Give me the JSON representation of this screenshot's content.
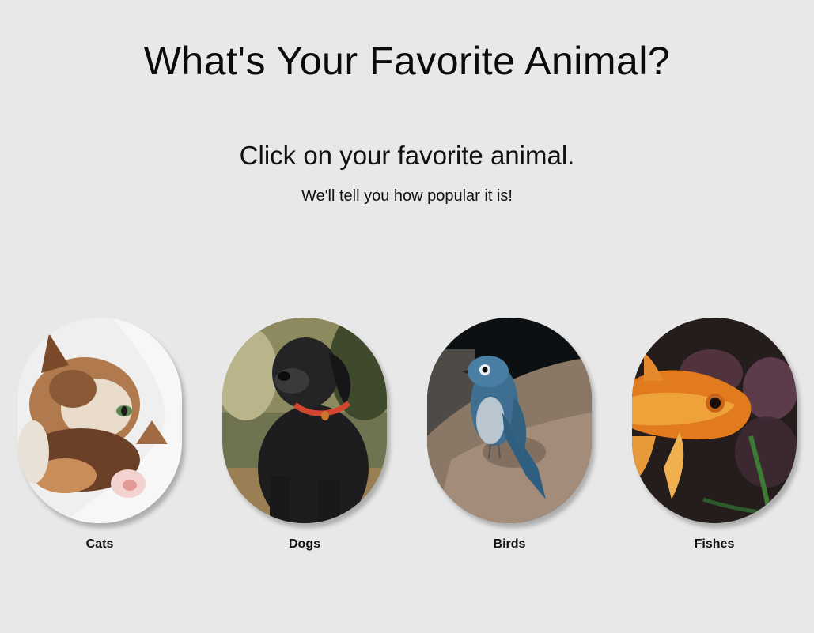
{
  "header": {
    "title": "What's Your Favorite Animal?",
    "subtitle": "Click on your favorite animal.",
    "tagline": "We'll tell you how popular it is!"
  },
  "animals": [
    {
      "label": "Cats",
      "image": "cat-photo"
    },
    {
      "label": "Dogs",
      "image": "dog-photo"
    },
    {
      "label": "Birds",
      "image": "bird-photo"
    },
    {
      "label": "Fishes",
      "image": "fish-photo"
    }
  ],
  "colors": {
    "background": "#e8e8e8",
    "text": "#111111"
  }
}
